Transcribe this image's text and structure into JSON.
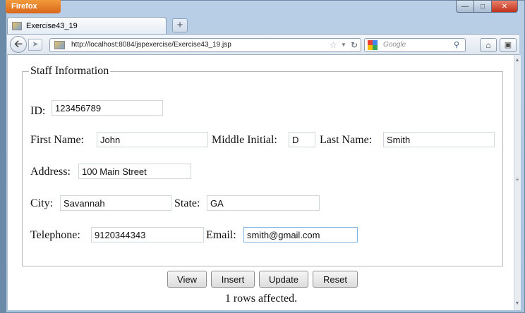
{
  "browser": {
    "app_button": "Firefox",
    "tab_title": "Exercise43_19",
    "url": "http://localhost:8084/jspexercise/Exercise43_19.jsp",
    "search_placeholder": "Google",
    "accent": "#e07a26"
  },
  "form": {
    "legend": "Staff Information",
    "id": {
      "label": "ID:",
      "value": "123456789"
    },
    "first_name": {
      "label": "First Name:",
      "value": "John"
    },
    "middle_initial": {
      "label": "Middle Initial:",
      "value": "D"
    },
    "last_name": {
      "label": "Last Name:",
      "value": "Smith"
    },
    "address": {
      "label": "Address:",
      "value": "100 Main Street"
    },
    "city": {
      "label": "City:",
      "value": "Savannah"
    },
    "state": {
      "label": "State:",
      "value": "GA"
    },
    "telephone": {
      "label": "Telephone:",
      "value": "9120344343"
    },
    "email": {
      "label": "Email:",
      "value": "smith@gmail.com"
    }
  },
  "buttons": {
    "view": "View",
    "insert": "Insert",
    "update": "Update",
    "reset": "Reset"
  },
  "status": "1 rows affected."
}
